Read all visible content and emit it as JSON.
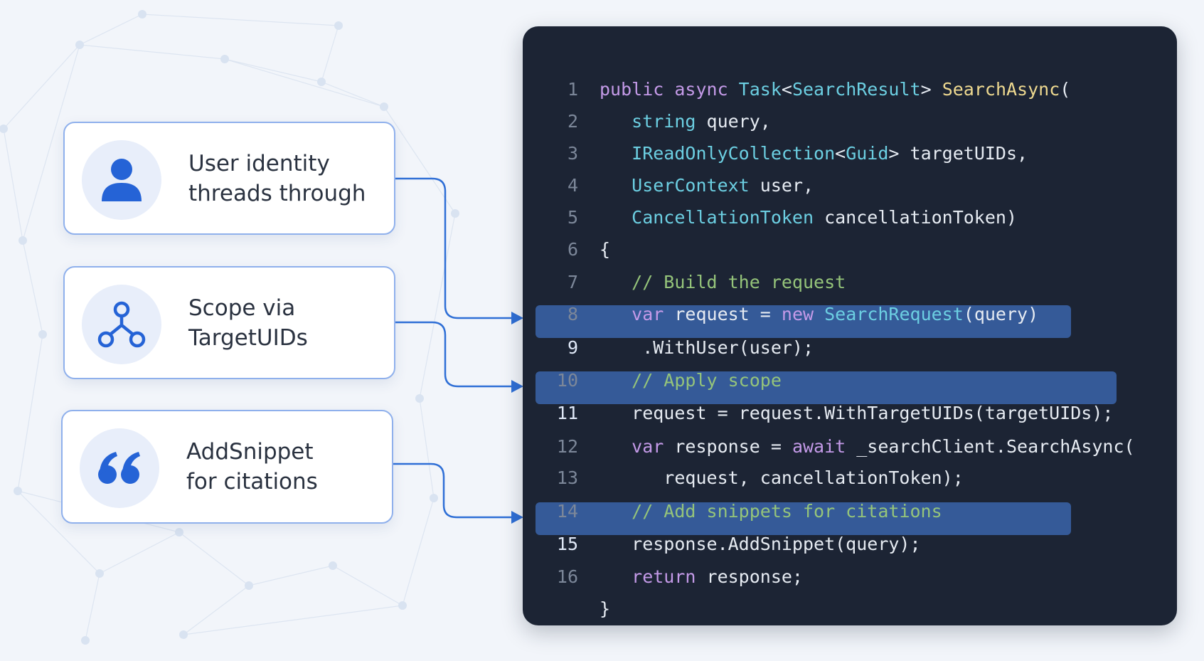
{
  "callouts": [
    {
      "icon": "user-icon",
      "lines": [
        "User identity",
        "threads through"
      ],
      "target_line": 9
    },
    {
      "icon": "branch-icon",
      "lines": [
        "Scope via",
        "TargetUIDs"
      ],
      "target_line": 11
    },
    {
      "icon": "quote-icon",
      "lines": [
        "AddSnippet",
        "for citations"
      ],
      "target_line": 15
    }
  ],
  "code": {
    "highlighted_lines": [
      9,
      11,
      15
    ],
    "lines": [
      {
        "num": "1",
        "tokens": [
          [
            "kw",
            "public "
          ],
          [
            "kw",
            "async "
          ],
          [
            "type",
            "Task"
          ],
          [
            "pl",
            "<"
          ],
          [
            "type",
            "SearchResult"
          ],
          [
            "pl",
            "> "
          ],
          [
            "fn",
            "SearchAsync"
          ],
          [
            "pl",
            "("
          ]
        ]
      },
      {
        "num": "2",
        "tokens": [
          [
            "pl",
            "   "
          ],
          [
            "type",
            "string"
          ],
          [
            "pl",
            " query,"
          ]
        ]
      },
      {
        "num": "3",
        "tokens": [
          [
            "pl",
            "   "
          ],
          [
            "type",
            "IReadOnlyCollection"
          ],
          [
            "pl",
            "<"
          ],
          [
            "type",
            "Guid"
          ],
          [
            "pl",
            "> targetUIDs,"
          ]
        ]
      },
      {
        "num": "4",
        "tokens": [
          [
            "pl",
            "   "
          ],
          [
            "type",
            "UserContext"
          ],
          [
            "pl",
            " user,"
          ]
        ]
      },
      {
        "num": "5",
        "tokens": [
          [
            "pl",
            "   "
          ],
          [
            "type",
            "CancellationToken"
          ],
          [
            "pl",
            " cancellationToken)"
          ]
        ]
      },
      {
        "num": "6",
        "tokens": [
          [
            "pl",
            "{"
          ]
        ]
      },
      {
        "num": "7",
        "tokens": [
          [
            "pl",
            "   "
          ],
          [
            "cm",
            "// Build the request"
          ]
        ]
      },
      {
        "num": "8",
        "tokens": [
          [
            "pl",
            "   "
          ],
          [
            "kw",
            "var"
          ],
          [
            "pl",
            " request = "
          ],
          [
            "kw",
            "new"
          ],
          [
            "pl",
            " "
          ],
          [
            "type",
            "SearchRequest"
          ],
          [
            "pl",
            "(query)"
          ]
        ]
      },
      {
        "num": "9",
        "tokens": [
          [
            "pl",
            "    .WithUser(user);"
          ]
        ]
      },
      {
        "num": "10",
        "tokens": [
          [
            "pl",
            "   "
          ],
          [
            "cm",
            "// Apply scope"
          ]
        ]
      },
      {
        "num": "11",
        "tokens": [
          [
            "pl",
            "   request = request.WithTargetUIDs(targetUIDs);"
          ]
        ]
      },
      {
        "num": "12",
        "tokens": [
          [
            "pl",
            "   "
          ],
          [
            "kw",
            "var"
          ],
          [
            "pl",
            " response = "
          ],
          [
            "kw",
            "await"
          ],
          [
            "pl",
            " _searchClient.SearchAsync("
          ]
        ]
      },
      {
        "num": "13",
        "tokens": [
          [
            "pl",
            "      request, cancellationToken);"
          ]
        ]
      },
      {
        "num": "14",
        "tokens": [
          [
            "pl",
            "   "
          ],
          [
            "cm",
            "// Add snippets for citations"
          ]
        ]
      },
      {
        "num": "15",
        "tokens": [
          [
            "pl",
            "   response.AddSnippet(query);"
          ]
        ]
      },
      {
        "num": "16",
        "tokens": [
          [
            "pl",
            "   "
          ],
          [
            "kw",
            "return"
          ],
          [
            "pl",
            " response;"
          ]
        ]
      },
      {
        "num": "",
        "tokens": [
          [
            "pl",
            "}"
          ]
        ]
      }
    ]
  },
  "colors": {
    "accent": "#2563d6",
    "connector": "#2f6fd6",
    "card_border": "#8fb0ec",
    "panel_bg": "#1c2434",
    "highlight_bg": "#355a98",
    "keyword": "#c49ae8",
    "type": "#6ccfe2",
    "function": "#eed990",
    "comment": "#95c47a",
    "plain": "#e6ebf2",
    "line_number": "#7c8799"
  }
}
